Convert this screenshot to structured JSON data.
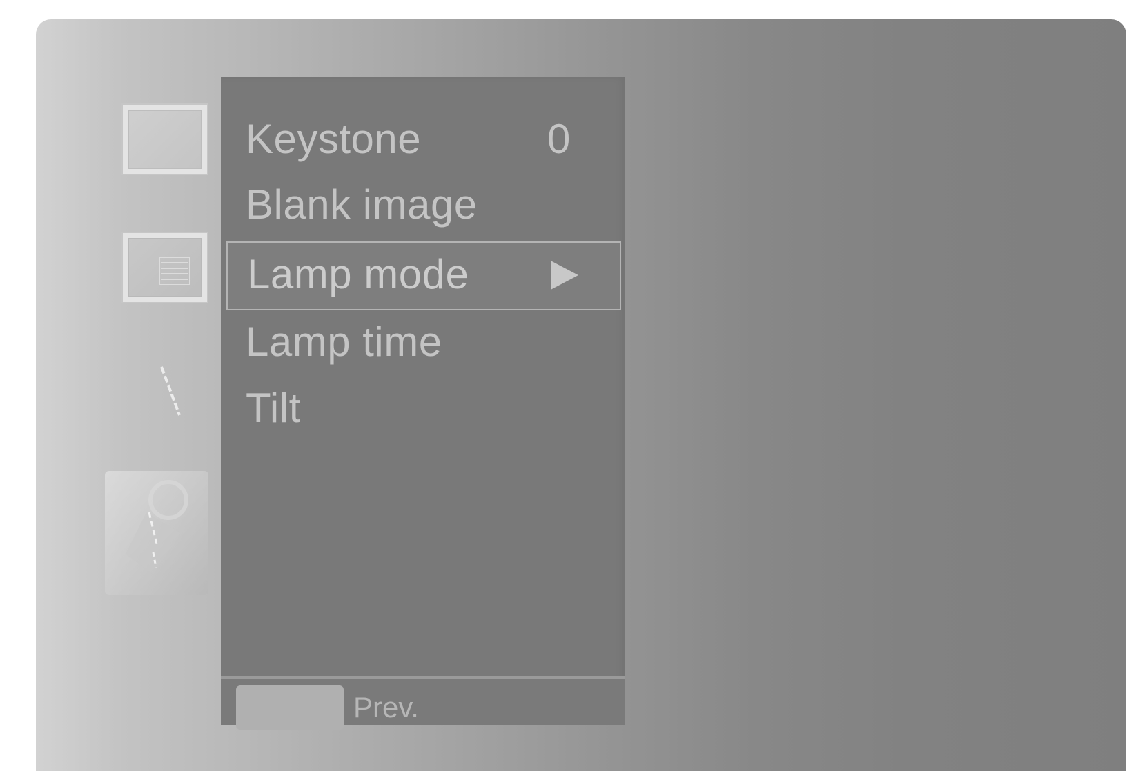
{
  "menu": {
    "items": [
      {
        "label": "Keystone",
        "value": "0"
      },
      {
        "label": "Blank image"
      },
      {
        "label": "Lamp mode",
        "selected": true,
        "icon": "play-arrow-icon"
      },
      {
        "label": "Lamp time"
      },
      {
        "label": "Tilt"
      }
    ]
  },
  "footer": {
    "prev_label": "Prev."
  },
  "icons": {
    "rail": [
      "screen-icon",
      "menu-list-icon",
      "tools-icon",
      "lamp-icon"
    ]
  },
  "colors": {
    "panel": "#797979",
    "text": "#c4c4c4",
    "selection_border": "#b4b4b4"
  }
}
